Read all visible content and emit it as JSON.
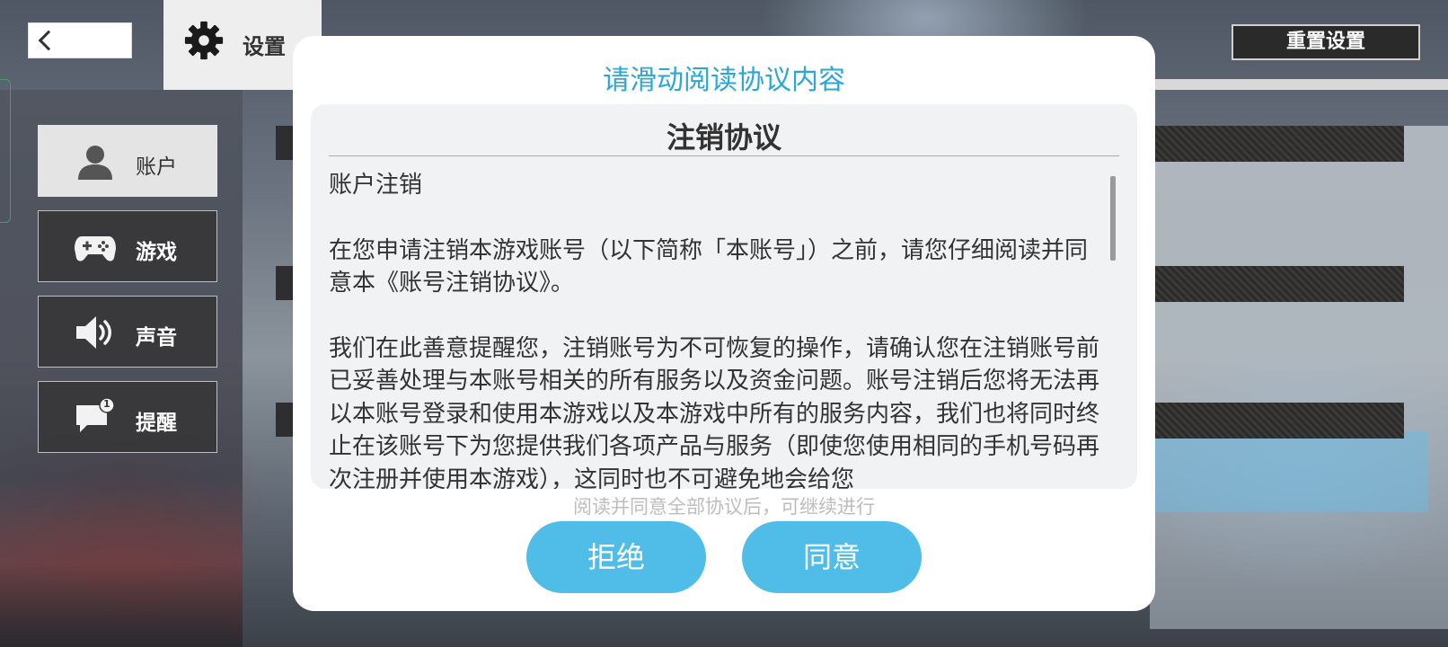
{
  "header": {
    "back_icon": "chevron-left-icon",
    "tab_icon": "gear-icon",
    "tab_title": "设置",
    "reset_label": "重置设置"
  },
  "sidebar": {
    "items": [
      {
        "label": "账户",
        "icon": "user-icon",
        "active": true
      },
      {
        "label": "游戏",
        "icon": "gamepad-icon",
        "active": false
      },
      {
        "label": "声音",
        "icon": "speaker-icon",
        "active": false
      },
      {
        "label": "提醒",
        "icon": "notification-bubble-icon",
        "badge": "1",
        "active": false
      }
    ]
  },
  "modal": {
    "title": "请滑动阅读协议内容",
    "document": {
      "title": "注销协议",
      "paragraphs": [
        "账户注销",
        "在您申请注销本游戏账号（以下简称「本账号」）之前，请您仔细阅读并同意本《账号注销协议》。",
        "我们在此善意提醒您，注销账号为不可恢复的操作，请确认您在注销账号前已妥善处理与本账号相关的所有服务以及资金问题。账号注销后您将无法再以本账号登录和使用本游戏以及本游戏中所有的服务内容，我们也将同时终止在该账号下为您提供我们各项产品与服务（即使您使用相同的手机号码再次注册并使用本游戏），这同时也不可避免地会给您"
      ]
    },
    "hint": "阅读并同意全部协议后，可继续进行",
    "reject_label": "拒绝",
    "agree_label": "同意"
  },
  "colors": {
    "accent": "#2aa7d8",
    "button": "#4fbde8"
  }
}
